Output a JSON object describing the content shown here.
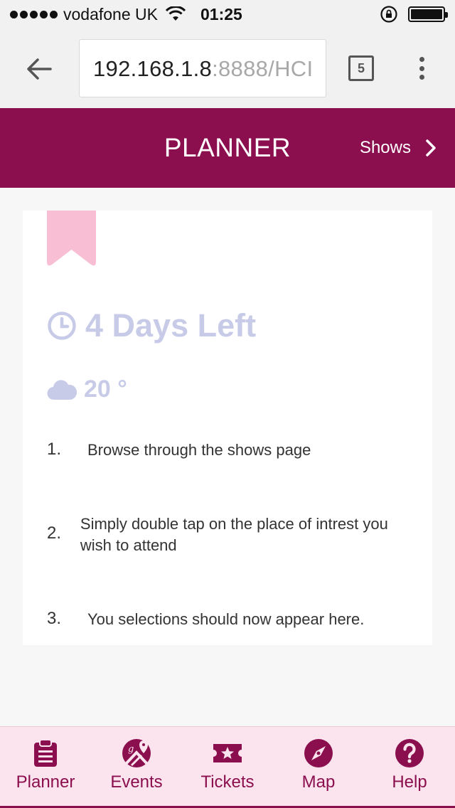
{
  "status_bar": {
    "carrier": "vodafone UK",
    "time": "01:25",
    "signal_bars": 5,
    "battery_level": 1.0
  },
  "browser": {
    "url_host": "192.168.1.8",
    "url_rest": ":8888/HCI",
    "tab_count": "5"
  },
  "header": {
    "title": "PLANNER",
    "shows_link": "Shows",
    "background_color": "#8b0f4e"
  },
  "card": {
    "days_left": "4 Days Left",
    "temperature": "20 °",
    "steps": [
      {
        "number": "1.",
        "text": "Browse through the shows page"
      },
      {
        "number": "2.",
        "text": "Simply double tap on the place of intrest you wish to attend"
      },
      {
        "number": "3.",
        "text": "You selections should now appear here."
      }
    ]
  },
  "tab_bar": {
    "tabs": [
      {
        "label": "Planner",
        "icon": "clipboard-icon"
      },
      {
        "label": "Events",
        "icon": "events-icon"
      },
      {
        "label": "Tickets",
        "icon": "ticket-icon"
      },
      {
        "label": "Map",
        "icon": "compass-icon"
      },
      {
        "label": "Help",
        "icon": "help-icon"
      }
    ],
    "accent_color": "#8b0f4e",
    "background_color": "#fbe4ed"
  }
}
